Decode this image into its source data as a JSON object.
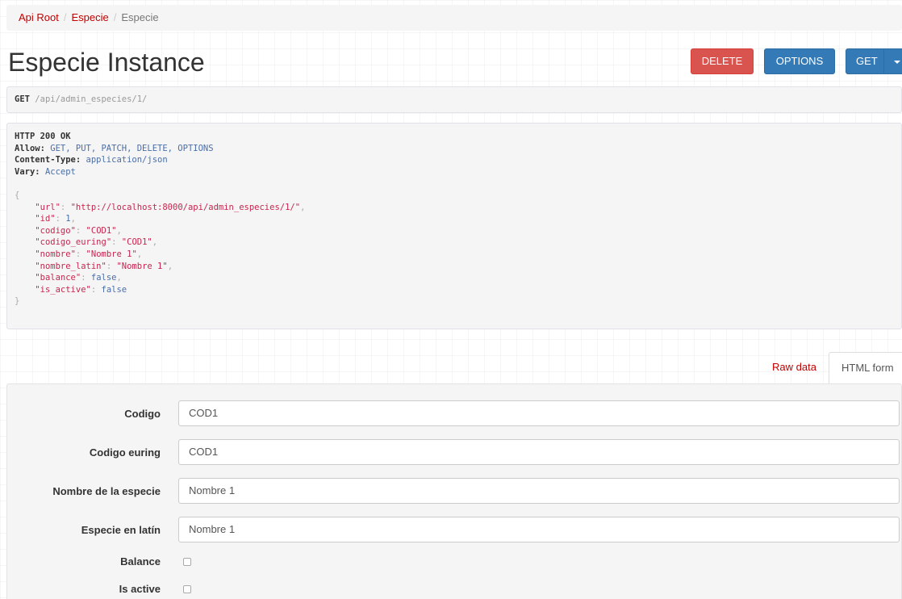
{
  "breadcrumb": {
    "items": [
      "Api Root",
      "Especie"
    ],
    "active": "Especie",
    "separator": "/"
  },
  "page_title": "Especie Instance",
  "buttons": {
    "delete": "DELETE",
    "options": "OPTIONS",
    "get": "GET"
  },
  "request": {
    "method": "GET",
    "path": "/api/admin_especies/1/"
  },
  "response": {
    "status": "HTTP 200 OK",
    "headers": [
      {
        "key": "Allow",
        "value": "GET, PUT, PATCH, DELETE, OPTIONS"
      },
      {
        "key": "Content-Type",
        "value": "application/json"
      },
      {
        "key": "Vary",
        "value": "Accept"
      }
    ],
    "body": [
      {
        "key": "url",
        "value": "\"http://localhost:8000/api/admin_especies/1/\"",
        "kind": "str"
      },
      {
        "key": "id",
        "value": "1",
        "kind": "lit"
      },
      {
        "key": "codigo",
        "value": "\"COD1\"",
        "kind": "str"
      },
      {
        "key": "codigo_euring",
        "value": "\"COD1\"",
        "kind": "str"
      },
      {
        "key": "nombre",
        "value": "\"Nombre 1\"",
        "kind": "str"
      },
      {
        "key": "nombre_latin",
        "value": "\"Nombre 1\"",
        "kind": "str"
      },
      {
        "key": "balance",
        "value": "false",
        "kind": "lit"
      },
      {
        "key": "is_active",
        "value": "false",
        "kind": "lit"
      }
    ]
  },
  "tabs": {
    "raw": "Raw data",
    "html": "HTML form",
    "active": "HTML form"
  },
  "form": {
    "fields": [
      {
        "label": "Codigo",
        "value": "COD1"
      },
      {
        "label": "Codigo euring",
        "value": "COD1"
      },
      {
        "label": "Nombre de la especie",
        "value": "Nombre 1"
      },
      {
        "label": "Especie en latín",
        "value": "Nombre 1"
      }
    ],
    "checkboxes": [
      {
        "label": "Balance",
        "checked": false
      },
      {
        "label": "Is active",
        "checked": false
      }
    ]
  },
  "colors": {
    "link": "#c20000",
    "danger": "#d9534f",
    "primary": "#337ab7"
  }
}
